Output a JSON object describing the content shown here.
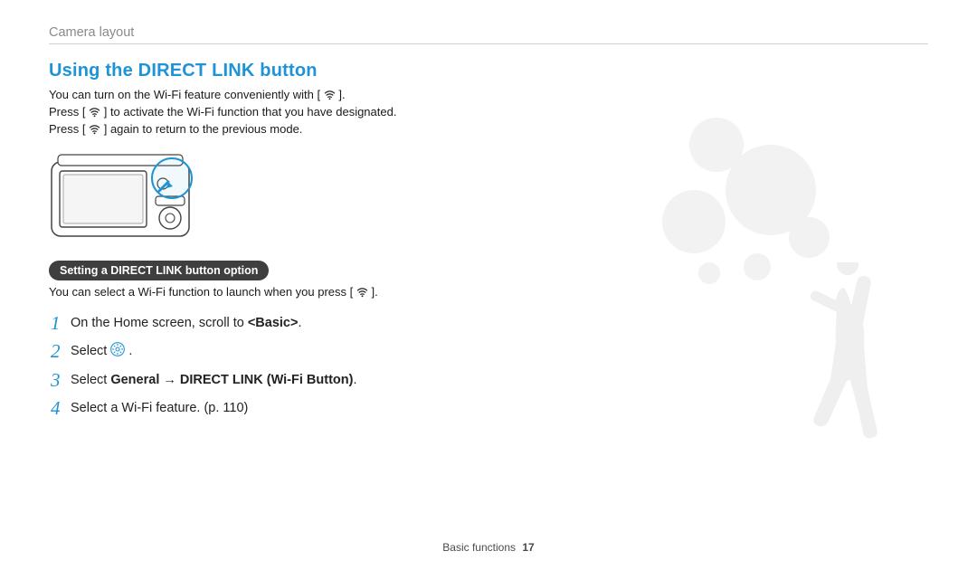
{
  "breadcrumb": "Camera layout",
  "section_title": "Using the DIRECT LINK button",
  "intro": {
    "line1_pre": "You can turn on the Wi-Fi feature conveniently with [",
    "line1_post": "].",
    "line2_pre": "Press [",
    "line2_post": "] to activate the Wi-Fi function that you have designated.",
    "line3_pre": "Press [",
    "line3_post": "] again to return to the previous mode."
  },
  "pill_label": "Setting a DIRECT LINK button option",
  "pill_desc_pre": "You can select a Wi-Fi function to launch when you press [",
  "pill_desc_post": "].",
  "steps": [
    {
      "num": "1",
      "html": "On the Home screen, scroll to <b>&lt;Basic&gt;</b>."
    },
    {
      "num": "2",
      "html": "Select {gearicon} ."
    },
    {
      "num": "3",
      "html": "Select <b>General</b> → <b>DIRECT LINK (Wi-Fi Button)</b>."
    },
    {
      "num": "4",
      "html": "Select a Wi-Fi feature. (p. 110)"
    }
  ],
  "footer_section": "Basic functions",
  "footer_page": "17"
}
